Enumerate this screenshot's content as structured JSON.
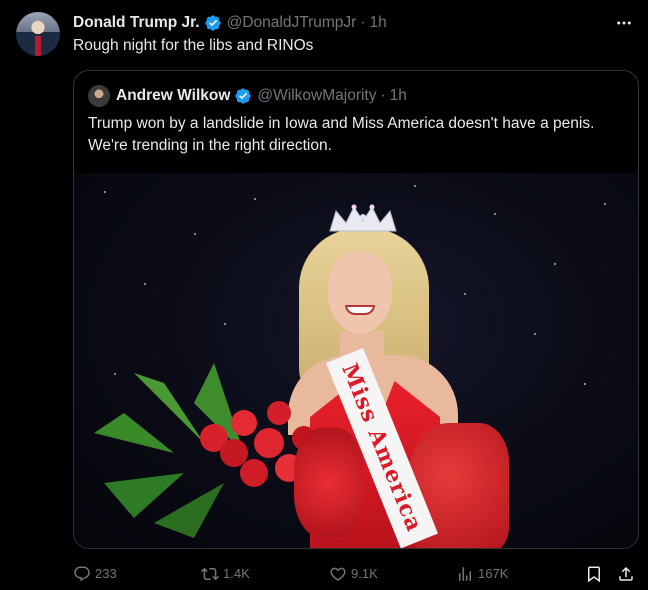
{
  "tweet": {
    "author_name": "Donald Trump Jr.",
    "author_handle": "@DonaldJTrumpJr",
    "separator": "·",
    "time": "1h",
    "text": "Rough night for the libs and RINOs"
  },
  "quoted_tweet": {
    "author_name": "Andrew Wilkow",
    "author_handle": "@WilkowMajority",
    "separator": "·",
    "time": "1h",
    "text": "Trump won by a landslide in Iowa and Miss America doesn't have a penis. We're trending in the right direction.",
    "image_sash_text": "Miss America"
  },
  "actions": {
    "replies": "233",
    "reposts": "1.4K",
    "likes": "9.1K",
    "views": "167K"
  },
  "colors": {
    "background": "#000000",
    "text": "#e7e9ea",
    "muted": "#71767b",
    "verified": "#1d9bf0",
    "border": "#2f3336"
  },
  "icons": [
    "more-icon",
    "verified-badge-icon",
    "reply-icon",
    "repost-icon",
    "like-icon",
    "views-icon",
    "bookmark-icon",
    "share-icon"
  ]
}
